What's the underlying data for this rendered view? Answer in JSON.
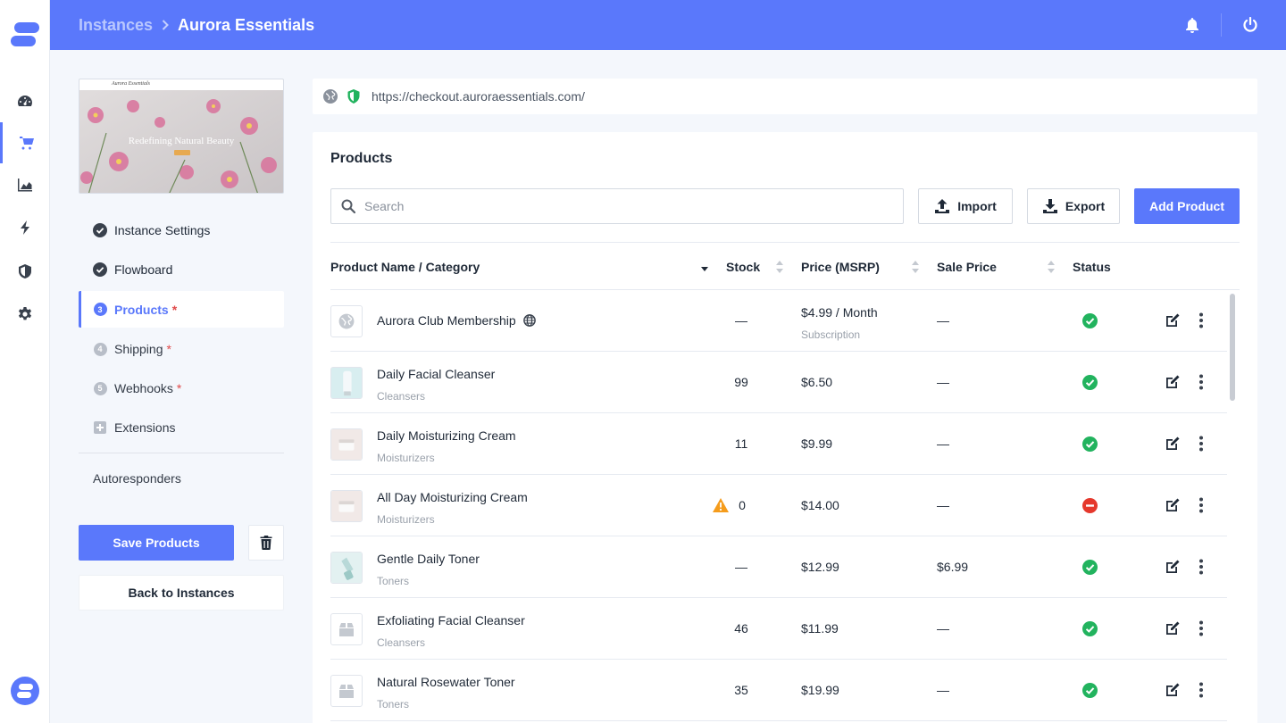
{
  "breadcrumb": {
    "root": "Instances",
    "current": "Aurora Essentials"
  },
  "preview": {
    "brand": "Aurora Essentials",
    "headline": "Redefining Natural Beauty"
  },
  "url": "https://checkout.auroraessentials.com/",
  "steps": [
    {
      "label": "Instance Settings",
      "state": "done"
    },
    {
      "label": "Flowboard",
      "state": "done"
    },
    {
      "label": "Products",
      "num": "3",
      "required": "*",
      "state": "active"
    },
    {
      "label": "Shipping",
      "num": "4",
      "required": "*",
      "state": "todo"
    },
    {
      "label": "Webhooks",
      "num": "5",
      "required": "*",
      "state": "todo"
    },
    {
      "label": "Extensions",
      "state": "add"
    }
  ],
  "autoresponders": "Autoresponders",
  "buttons": {
    "save": "Save Products",
    "back": "Back to Instances",
    "import": "Import",
    "export": "Export",
    "add": "Add Product"
  },
  "panel": {
    "title": "Products",
    "search_placeholder": "Search"
  },
  "columns": {
    "name": "Product Name / Category",
    "stock": "Stock",
    "price": "Price (MSRP)",
    "sale": "Sale Price",
    "status": "Status"
  },
  "products": [
    {
      "name": "Aurora Club Membership",
      "category": "",
      "stock": "—",
      "price": "$4.99 / Month",
      "price_sub": "Subscription",
      "sale": "—",
      "status": "active",
      "thumb": "globe"
    },
    {
      "name": "Daily Facial Cleanser",
      "category": "Cleansers",
      "stock": "99",
      "price": "$6.50",
      "price_sub": "",
      "sale": "—",
      "status": "active",
      "thumb": "tube"
    },
    {
      "name": "Daily Moisturizing Cream",
      "category": "Moisturizers",
      "stock": "11",
      "price": "$9.99",
      "price_sub": "",
      "sale": "—",
      "status": "active",
      "thumb": "jar"
    },
    {
      "name": "All Day Moisturizing Cream",
      "category": "Moisturizers",
      "stock": "0",
      "price": "$14.00",
      "price_sub": "",
      "sale": "—",
      "status": "inactive",
      "thumb": "jar",
      "warning": true
    },
    {
      "name": "Gentle Daily Toner",
      "category": "Toners",
      "stock": "—",
      "price": "$12.99",
      "price_sub": "",
      "sale": "$6.99",
      "status": "active",
      "thumb": "bottle"
    },
    {
      "name": "Exfoliating Facial Cleanser",
      "category": "Cleansers",
      "stock": "46",
      "price": "$11.99",
      "price_sub": "",
      "sale": "—",
      "status": "active",
      "thumb": "box"
    },
    {
      "name": "Natural Rosewater Toner",
      "category": "Toners",
      "stock": "35",
      "price": "$19.99",
      "price_sub": "",
      "sale": "—",
      "status": "active",
      "thumb": "box"
    }
  ],
  "colors": {
    "accent": "#5a78fb",
    "success": "#22b35e",
    "danger": "#e5382c",
    "warning": "#f59c1c"
  }
}
